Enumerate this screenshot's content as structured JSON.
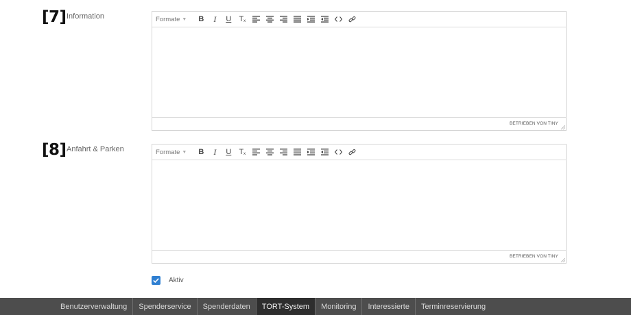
{
  "fields": [
    {
      "marker": "[7]",
      "label": "Information",
      "editor": {
        "format_label": "Formate",
        "statusbar_text": "BETRIEBEN VON TINY"
      }
    },
    {
      "marker": "[8]",
      "label": "Anfahrt & Parken",
      "editor": {
        "format_label": "Formate",
        "statusbar_text": "BETRIEBEN VON TINY"
      }
    }
  ],
  "toolbar_buttons": {
    "bold": "B",
    "italic": "I",
    "underline": "U",
    "clear": "T",
    "clear_sub": "x"
  },
  "active_checkbox": {
    "label": "Aktiv",
    "checked": true
  },
  "bottom_nav": {
    "items": [
      "Benutzerverwaltung",
      "Spenderservice",
      "Spenderdaten",
      "TORT-System",
      "Monitoring",
      "Interessierte",
      "Terminreservierung"
    ],
    "active_index": 3
  },
  "colors": {
    "accent": "#2f7fd1",
    "nav_background": "#4d4d4d",
    "nav_active": "#2e2e2e"
  }
}
